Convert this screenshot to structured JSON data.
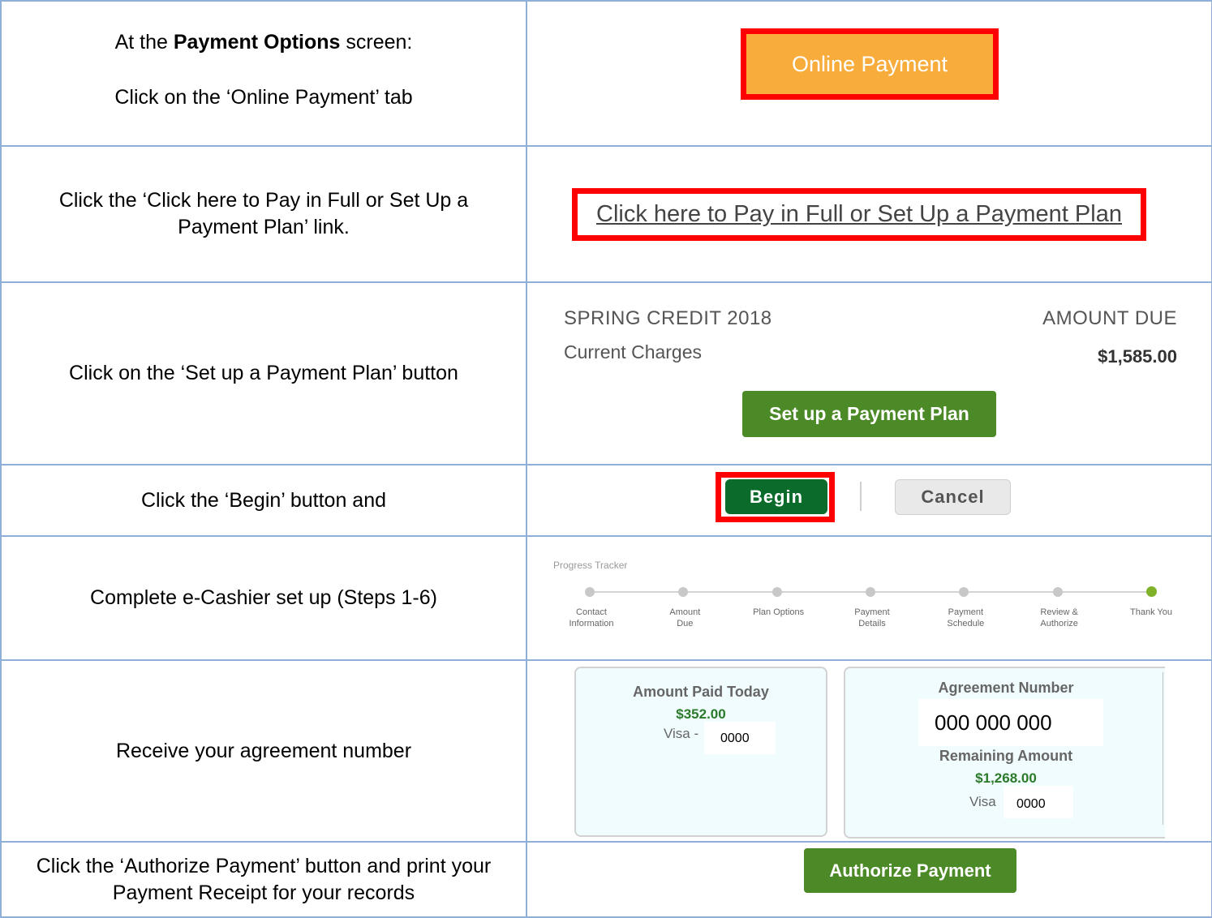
{
  "steps": [
    {
      "instruction_prefix": "At the ",
      "instruction_bold": "Payment Options",
      "instruction_suffix": " screen:",
      "instruction_line2": "Click on the ‘Online Payment’ tab",
      "button_label": "Online Payment"
    },
    {
      "instruction": "Click the ‘Click here to Pay in Full or Set Up a Payment Plan’ link.",
      "link_label": "Click here to Pay in Full or Set Up a Payment Plan"
    },
    {
      "instruction": "Click on the ‘Set up a Payment Plan’ button",
      "term": "SPRING CREDIT 2018",
      "amount_due_label": "AMOUNT DUE",
      "charges_label": "Current Charges",
      "charges_value": "$1,585.00",
      "button_label": "Set up a Payment Plan"
    },
    {
      "instruction": "Click the ‘Begin’ button and",
      "begin_label": "Begin",
      "cancel_label": "Cancel"
    },
    {
      "instruction": "Complete e-Cashier set up (Steps 1-6)",
      "tracker_label": "Progress Tracker",
      "tracker_steps": [
        {
          "line1": "Contact",
          "line2": "Information"
        },
        {
          "line1": "Amount",
          "line2": "Due"
        },
        {
          "line1": "Plan Options",
          "line2": ""
        },
        {
          "line1": "Payment",
          "line2": "Details"
        },
        {
          "line1": "Payment",
          "line2": "Schedule"
        },
        {
          "line1": "Review &",
          "line2": "Authorize"
        },
        {
          "line1": "Thank You",
          "line2": ""
        }
      ],
      "current_step": 7
    },
    {
      "instruction": "Receive your agreement number",
      "paid_today_label": "Amount Paid Today",
      "paid_today_value": "$352.00",
      "paid_card_label": "Visa -",
      "paid_card_digits": "0000",
      "agreement_label": "Agreement Number",
      "agreement_value": "000 000 000",
      "remaining_label": "Remaining Amount",
      "remaining_value": "$1,268.00",
      "remaining_card_label": "Visa",
      "remaining_card_digits": "0000"
    },
    {
      "instruction": "Click the ‘Authorize Payment’ button and print your Payment Receipt for your records",
      "button_label": "Authorize Payment"
    }
  ],
  "colors": {
    "highlight_frame": "#ff0000",
    "online_payment_bg": "#f8ac3c",
    "green_button": "#4b8a26",
    "begin_button": "#0a6b2a",
    "money_green": "#2a7a2a",
    "progress_done": "#7fb228",
    "table_border": "#8eb0d8"
  }
}
